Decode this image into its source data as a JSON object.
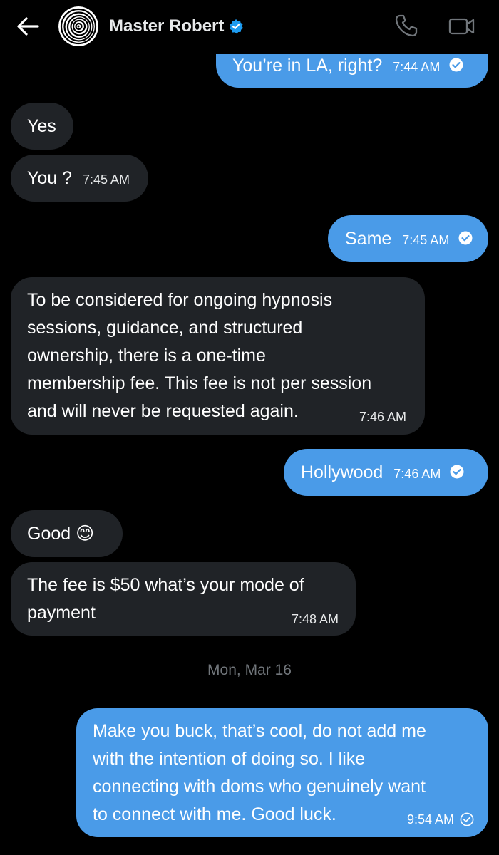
{
  "header": {
    "contact_name": "Master Robert",
    "verified": true,
    "accent_color": "#4a9be8"
  },
  "messages": [
    {
      "direction": "out",
      "text": "You’re in LA, right?",
      "time": "7:44 AM",
      "status": "read"
    },
    {
      "direction": "in",
      "text": "Yes",
      "time": ""
    },
    {
      "direction": "in",
      "text": "You ?",
      "time": "7:45 AM"
    },
    {
      "direction": "out",
      "text": "Same",
      "time": "7:45 AM",
      "status": "read"
    },
    {
      "direction": "in",
      "lines": [
        "To be considered for ongoing hypnosis",
        "sessions, guidance, and structured",
        "ownership, there is a one-time",
        "membership fee. This fee is not per session",
        "and will never be requested again."
      ],
      "time": "7:46 AM"
    },
    {
      "direction": "out",
      "text": "Hollywood",
      "time": "7:46 AM",
      "status": "read"
    },
    {
      "direction": "in",
      "text": "Good 😊",
      "time": ""
    },
    {
      "direction": "in",
      "lines": [
        "The fee is $50 what’s your mode of",
        "payment"
      ],
      "time": "7:48 AM"
    },
    {
      "direction": "out",
      "lines": [
        "Make you buck, that’s cool, do not add me",
        "with the intention of doing so. I like",
        "connecting with doms who genuinely want",
        "to connect with me. Good luck."
      ],
      "time": "9:54 AM",
      "status": "sent"
    }
  ],
  "date_separator": "Mon, Mar 16"
}
